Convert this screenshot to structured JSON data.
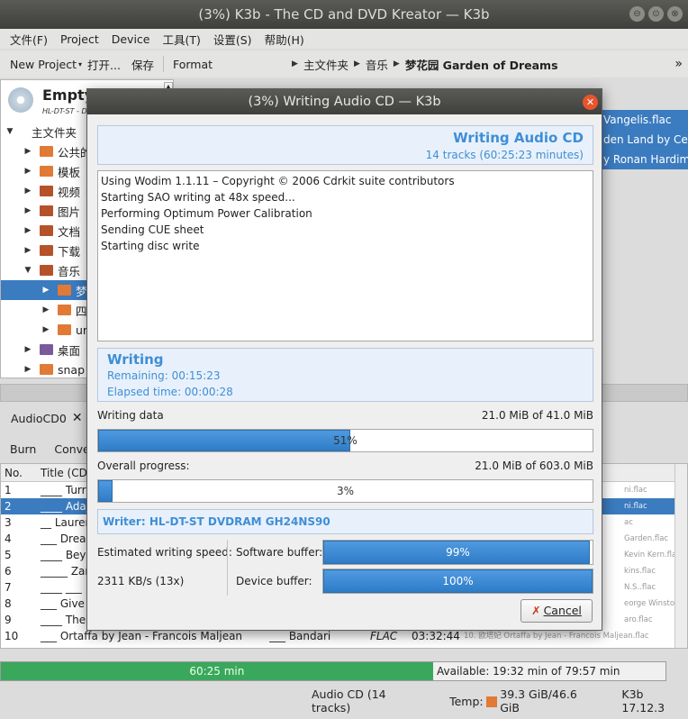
{
  "window": {
    "title": "(3%) K3b - The CD and DVD Kreator — K3b",
    "btn_min": "⊖",
    "btn_max": "⊙",
    "btn_close": "⊗"
  },
  "menu": [
    "文件(F)",
    "Project",
    "Device",
    "工具(T)",
    "设置(S)",
    "帮助(H)"
  ],
  "toolbar": {
    "new_project": "New Project",
    "open": "打开...",
    "save": "保存",
    "format": "Format",
    "breadcrumb": [
      "主文件夹",
      "音乐",
      "梦花园 Garden of Dreams"
    ],
    "overflow": "»"
  },
  "left_pane": {
    "heading": "Empty",
    "device": "HL-DT-ST - D",
    "tree": [
      {
        "label": "主文件夹",
        "twisty": "▼"
      },
      {
        "label": "公共的",
        "twisty": "▶"
      },
      {
        "label": "模板",
        "twisty": "▶"
      },
      {
        "label": "视频",
        "twisty": "▶"
      },
      {
        "label": "图片",
        "twisty": "▶"
      },
      {
        "label": "文档",
        "twisty": "▶"
      },
      {
        "label": "下载",
        "twisty": "▶"
      },
      {
        "label": "音乐",
        "twisty": "▼"
      },
      {
        "label": "梦",
        "twisty": "▶"
      },
      {
        "label": "四",
        "twisty": "▶"
      },
      {
        "label": "ur",
        "twisty": "▶"
      },
      {
        "label": "桌面",
        "twisty": "▶"
      },
      {
        "label": "snap",
        "twisty": "▶"
      }
    ]
  },
  "right_strip": [
    "Vangelis.flac",
    "den Land by Cere",
    "y Ronan Hardiman"
  ],
  "project_tab": {
    "label": "AudioCD0",
    "close": "✕"
  },
  "project_toolbar": [
    "Burn",
    "Conve"
  ],
  "track_table": {
    "headers": {
      "no": "No.",
      "title": "Title (CD-T"
    },
    "rows": [
      {
        "no": "1",
        "title": "____ Turr",
        "file": "ni.flac"
      },
      {
        "no": "2",
        "title": "____ Adaj",
        "file": "ni.flac"
      },
      {
        "no": "3",
        "title": "__ Lauren",
        "file": "ac"
      },
      {
        "no": "4",
        "title": "___ Dream",
        "file": "Garden.flac"
      },
      {
        "no": "5",
        "title": "____ Beyo",
        "file": "Kevin Kern.flac"
      },
      {
        "no": "6",
        "title": "_____ Zar",
        "file": "kins.flac"
      },
      {
        "no": "7",
        "title": "____ ___",
        "file": "N.S..flac"
      },
      {
        "no": "8",
        "title": "___ Give",
        "file": "eorge Winston.flac"
      },
      {
        "no": "9",
        "title": "____ The",
        "file": "aro.flac"
      },
      {
        "no": "10",
        "title": "___ Ortaffa by Jean - Francois Maljean",
        "artist": "___ Bandari",
        "type": "FLAC",
        "length": "03:32:44",
        "file": "10. 欧塔妃 Ortaffa by Jean - Francois Maljean.flac"
      }
    ]
  },
  "capacity": {
    "used_label": "60:25 min",
    "available_label": "Available: 19:32 min of 79:57 min",
    "fill_fraction": 0.65
  },
  "status_bar": {
    "project": "Audio CD (14 tracks)",
    "temp_label": "Temp:",
    "temp_value": "39.3 GiB/46.6 GiB",
    "version": "K3b 17.12.3"
  },
  "dialog": {
    "title": "(3%) Writing Audio CD — K3b",
    "close": "✕",
    "header_title": "Writing Audio CD",
    "header_sub": "14 tracks (60:25:23 minutes)",
    "log": [
      "Using Wodim 1.1.11 – Copyright © 2006 Cdrkit suite contributors",
      "Starting SAO writing at 48x speed...",
      "Performing Optimum Power Calibration",
      "Sending CUE sheet",
      "Starting disc write"
    ],
    "status_title": "Writing",
    "remaining": "Remaining: 00:15:23",
    "elapsed": "Elapsed time: 00:00:28",
    "writing_data_label": "Writing data",
    "writing_data_value": "21.0 MiB of 41.0 MiB",
    "writing_data_percent": 51,
    "writing_data_text": "51%",
    "overall_label": "Overall progress:",
    "overall_value": "21.0 MiB of 603.0 MiB",
    "overall_percent": 3,
    "overall_text": "3%",
    "writer": "Writer: HL-DT-ST DVDRAM GH24NS90",
    "speed_label": "Estimated writing speed:",
    "speed_value": "2311 KB/s (13x)",
    "software_buffer_label": "Software buffer:",
    "software_buffer_percent": 99,
    "software_buffer_text": "99%",
    "device_buffer_label": "Device buffer:",
    "device_buffer_percent": 100,
    "device_buffer_text": "100%",
    "cancel_icon": "✗",
    "cancel_label": "Cancel"
  }
}
